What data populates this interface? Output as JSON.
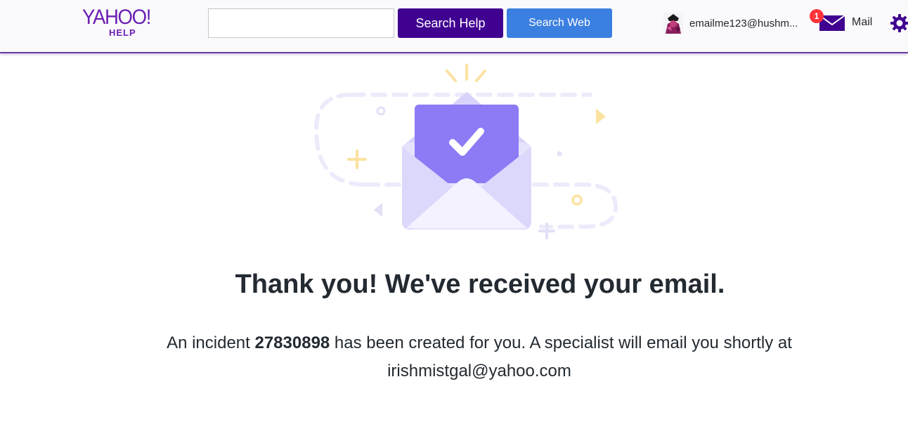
{
  "header": {
    "logo": {
      "main": "YAHOO!",
      "sub": "HELP"
    },
    "search": {
      "value": "",
      "placeholder": ""
    },
    "search_help_label": "Search Help",
    "search_web_label": "Search Web",
    "profile": {
      "name": "emailme123@hushm..."
    },
    "mail": {
      "label": "Mail",
      "badge_count": "1"
    },
    "icons": {
      "avatar": "avatar",
      "mail": "mail-envelope-icon",
      "settings": "gear-icon"
    }
  },
  "colors": {
    "brand_purple": "#400090",
    "search_web_blue": "#3b7fe0",
    "badge_red": "#ff333a",
    "envelope_purple": "#8b7bf5"
  },
  "confirmation": {
    "illustration": "envelope-check-icon",
    "headline": "Thank you! We've received your email.",
    "message": {
      "prefix": "An incident ",
      "incident_number": "27830898",
      "middle": " has been created for you. A specialist will email you shortly at",
      "email": "irishmistgal@yahoo.com"
    }
  }
}
